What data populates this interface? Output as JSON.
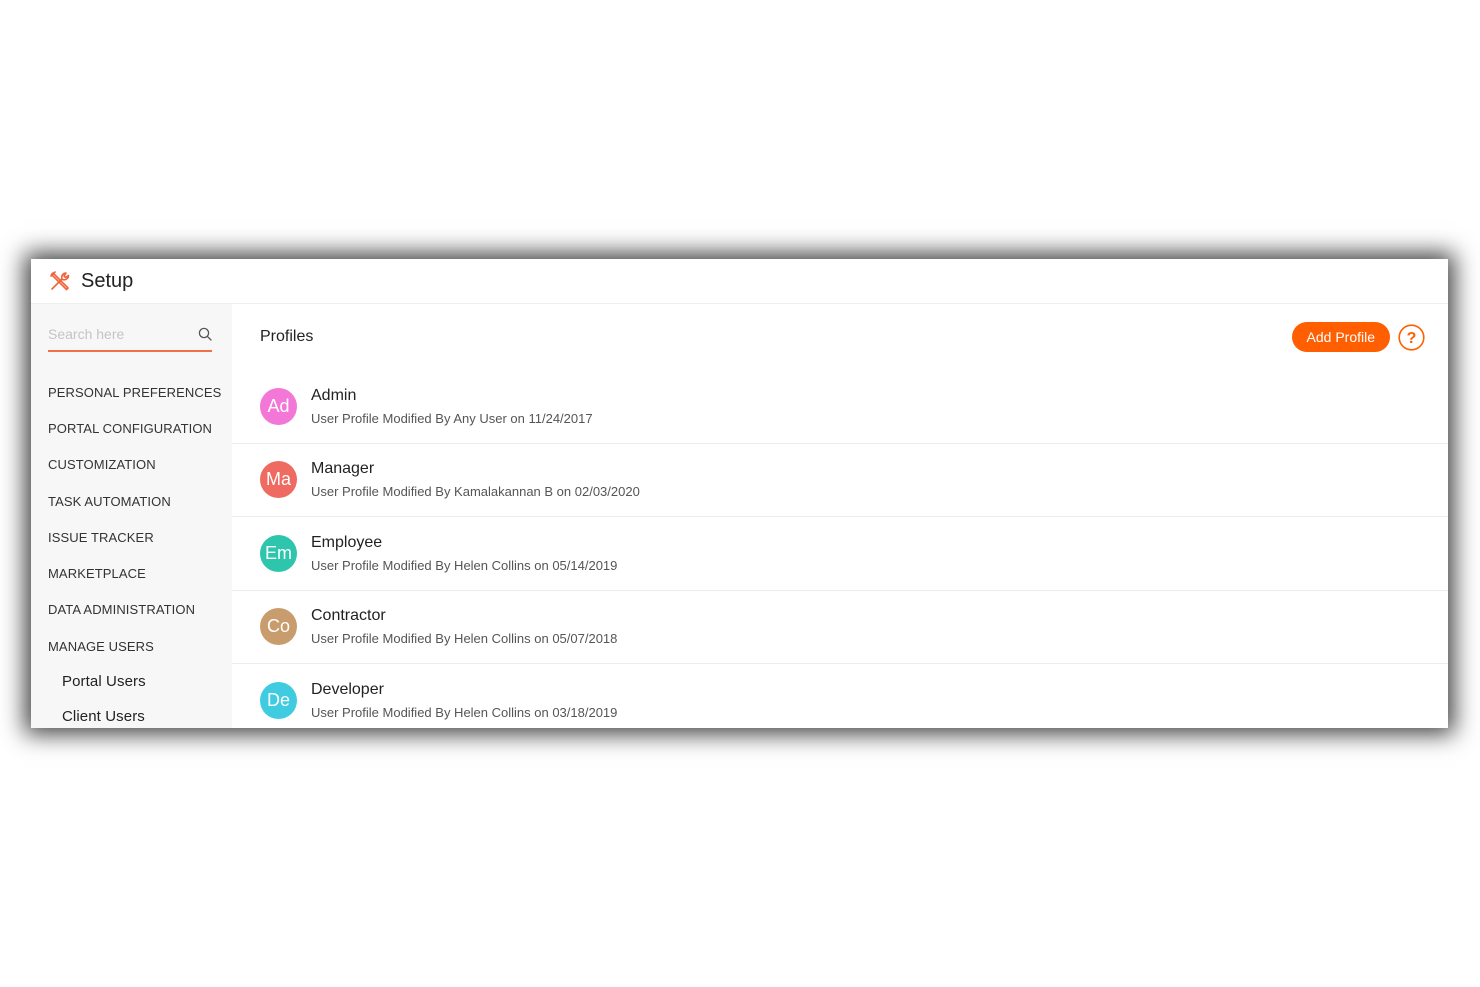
{
  "app": {
    "title": "Setup"
  },
  "search": {
    "placeholder": "Search here"
  },
  "sidebar": {
    "items": [
      {
        "label": "PERSONAL PREFERENCES"
      },
      {
        "label": "PORTAL CONFIGURATION"
      },
      {
        "label": "CUSTOMIZATION"
      },
      {
        "label": "TASK AUTOMATION"
      },
      {
        "label": "ISSUE TRACKER"
      },
      {
        "label": "MARKETPLACE"
      },
      {
        "label": "DATA ADMINISTRATION"
      },
      {
        "label": "MANAGE USERS"
      }
    ],
    "subitems": [
      {
        "label": "Portal Users"
      },
      {
        "label": "Client Users"
      }
    ]
  },
  "main": {
    "heading": "Profiles",
    "add_button": "Add Profile",
    "help_glyph": "?",
    "profiles": [
      {
        "initials": "Ad",
        "name": "Admin",
        "meta": "User Profile Modified By Any User on 11/24/2017",
        "color": "#f277d6"
      },
      {
        "initials": "Ma",
        "name": "Manager",
        "meta": "User Profile Modified By Kamalakannan B on 02/03/2020",
        "color": "#ef6a60"
      },
      {
        "initials": "Em",
        "name": "Employee",
        "meta": "User Profile Modified By Helen Collins on 05/14/2019",
        "color": "#2ec5ad"
      },
      {
        "initials": "Co",
        "name": "Contractor",
        "meta": "User Profile Modified By Helen Collins on 05/07/2018",
        "color": "#c99c6e"
      },
      {
        "initials": "De",
        "name": "Developer",
        "meta": "User Profile Modified By Helen Collins on 03/18/2019",
        "color": "#3fcbe0"
      }
    ]
  },
  "colors": {
    "accent": "#ff5f00",
    "search_underline": "#f07048",
    "sidebar_bg": "#f7f7f7"
  },
  "icons": {
    "title": "tools-icon",
    "search": "search-icon",
    "help": "help-icon"
  }
}
